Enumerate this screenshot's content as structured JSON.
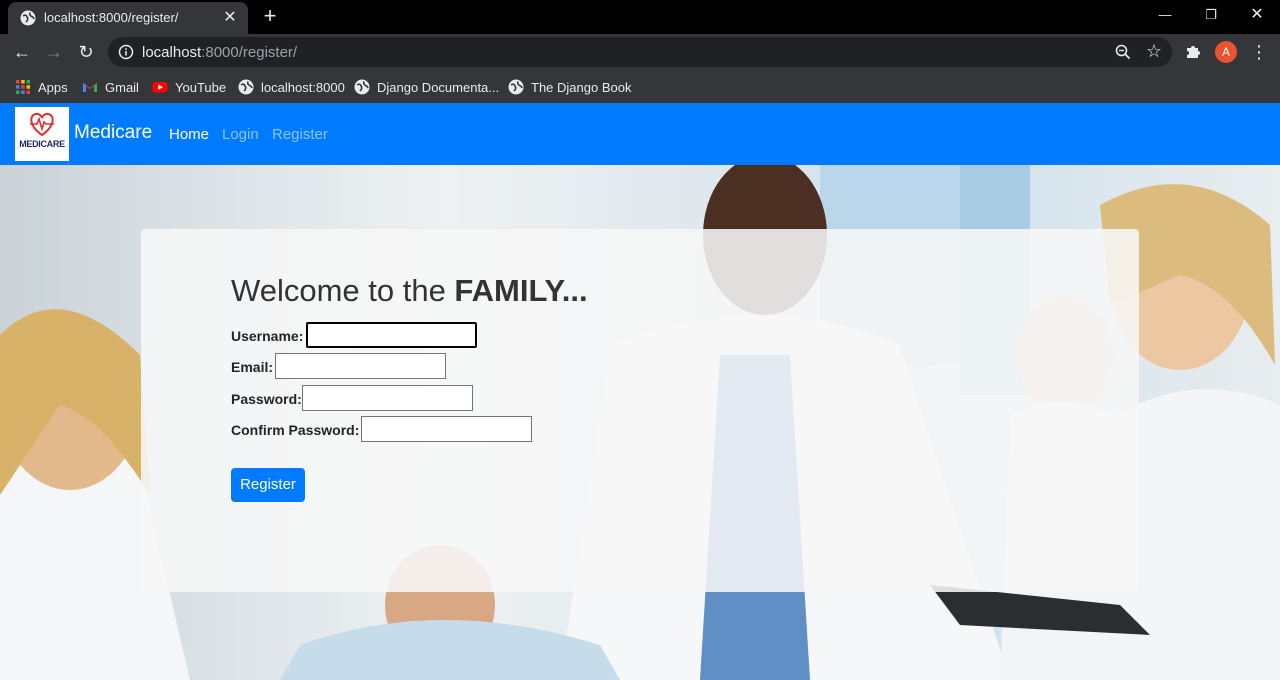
{
  "browser": {
    "tab_title": "localhost:8000/register/",
    "url_host": "localhost",
    "url_rest": ":8000/register/",
    "profile_initial": "A",
    "bookmarks": [
      {
        "label": "Apps",
        "icon": "apps-grid-icon"
      },
      {
        "label": "Gmail",
        "icon": "gmail-icon"
      },
      {
        "label": "YouTube",
        "icon": "youtube-icon"
      },
      {
        "label": "localhost:8000",
        "icon": "globe-icon"
      },
      {
        "label": "Django Documenta...",
        "icon": "globe-icon"
      },
      {
        "label": "The Django Book",
        "icon": "globe-icon"
      }
    ]
  },
  "navbar": {
    "logo_text": "MEDICARE",
    "brand": "Medicare",
    "links": [
      "Home",
      "Login",
      "Register"
    ],
    "color": "#007bff"
  },
  "form": {
    "heading_prefix": "Welcome to the ",
    "heading_bold": "FAMILY...",
    "fields": [
      {
        "label": "Username:",
        "value": ""
      },
      {
        "label": "Email:",
        "value": ""
      },
      {
        "label": "Password:",
        "value": ""
      },
      {
        "label": "Confirm Password:",
        "value": ""
      }
    ],
    "submit_label": "Register"
  }
}
